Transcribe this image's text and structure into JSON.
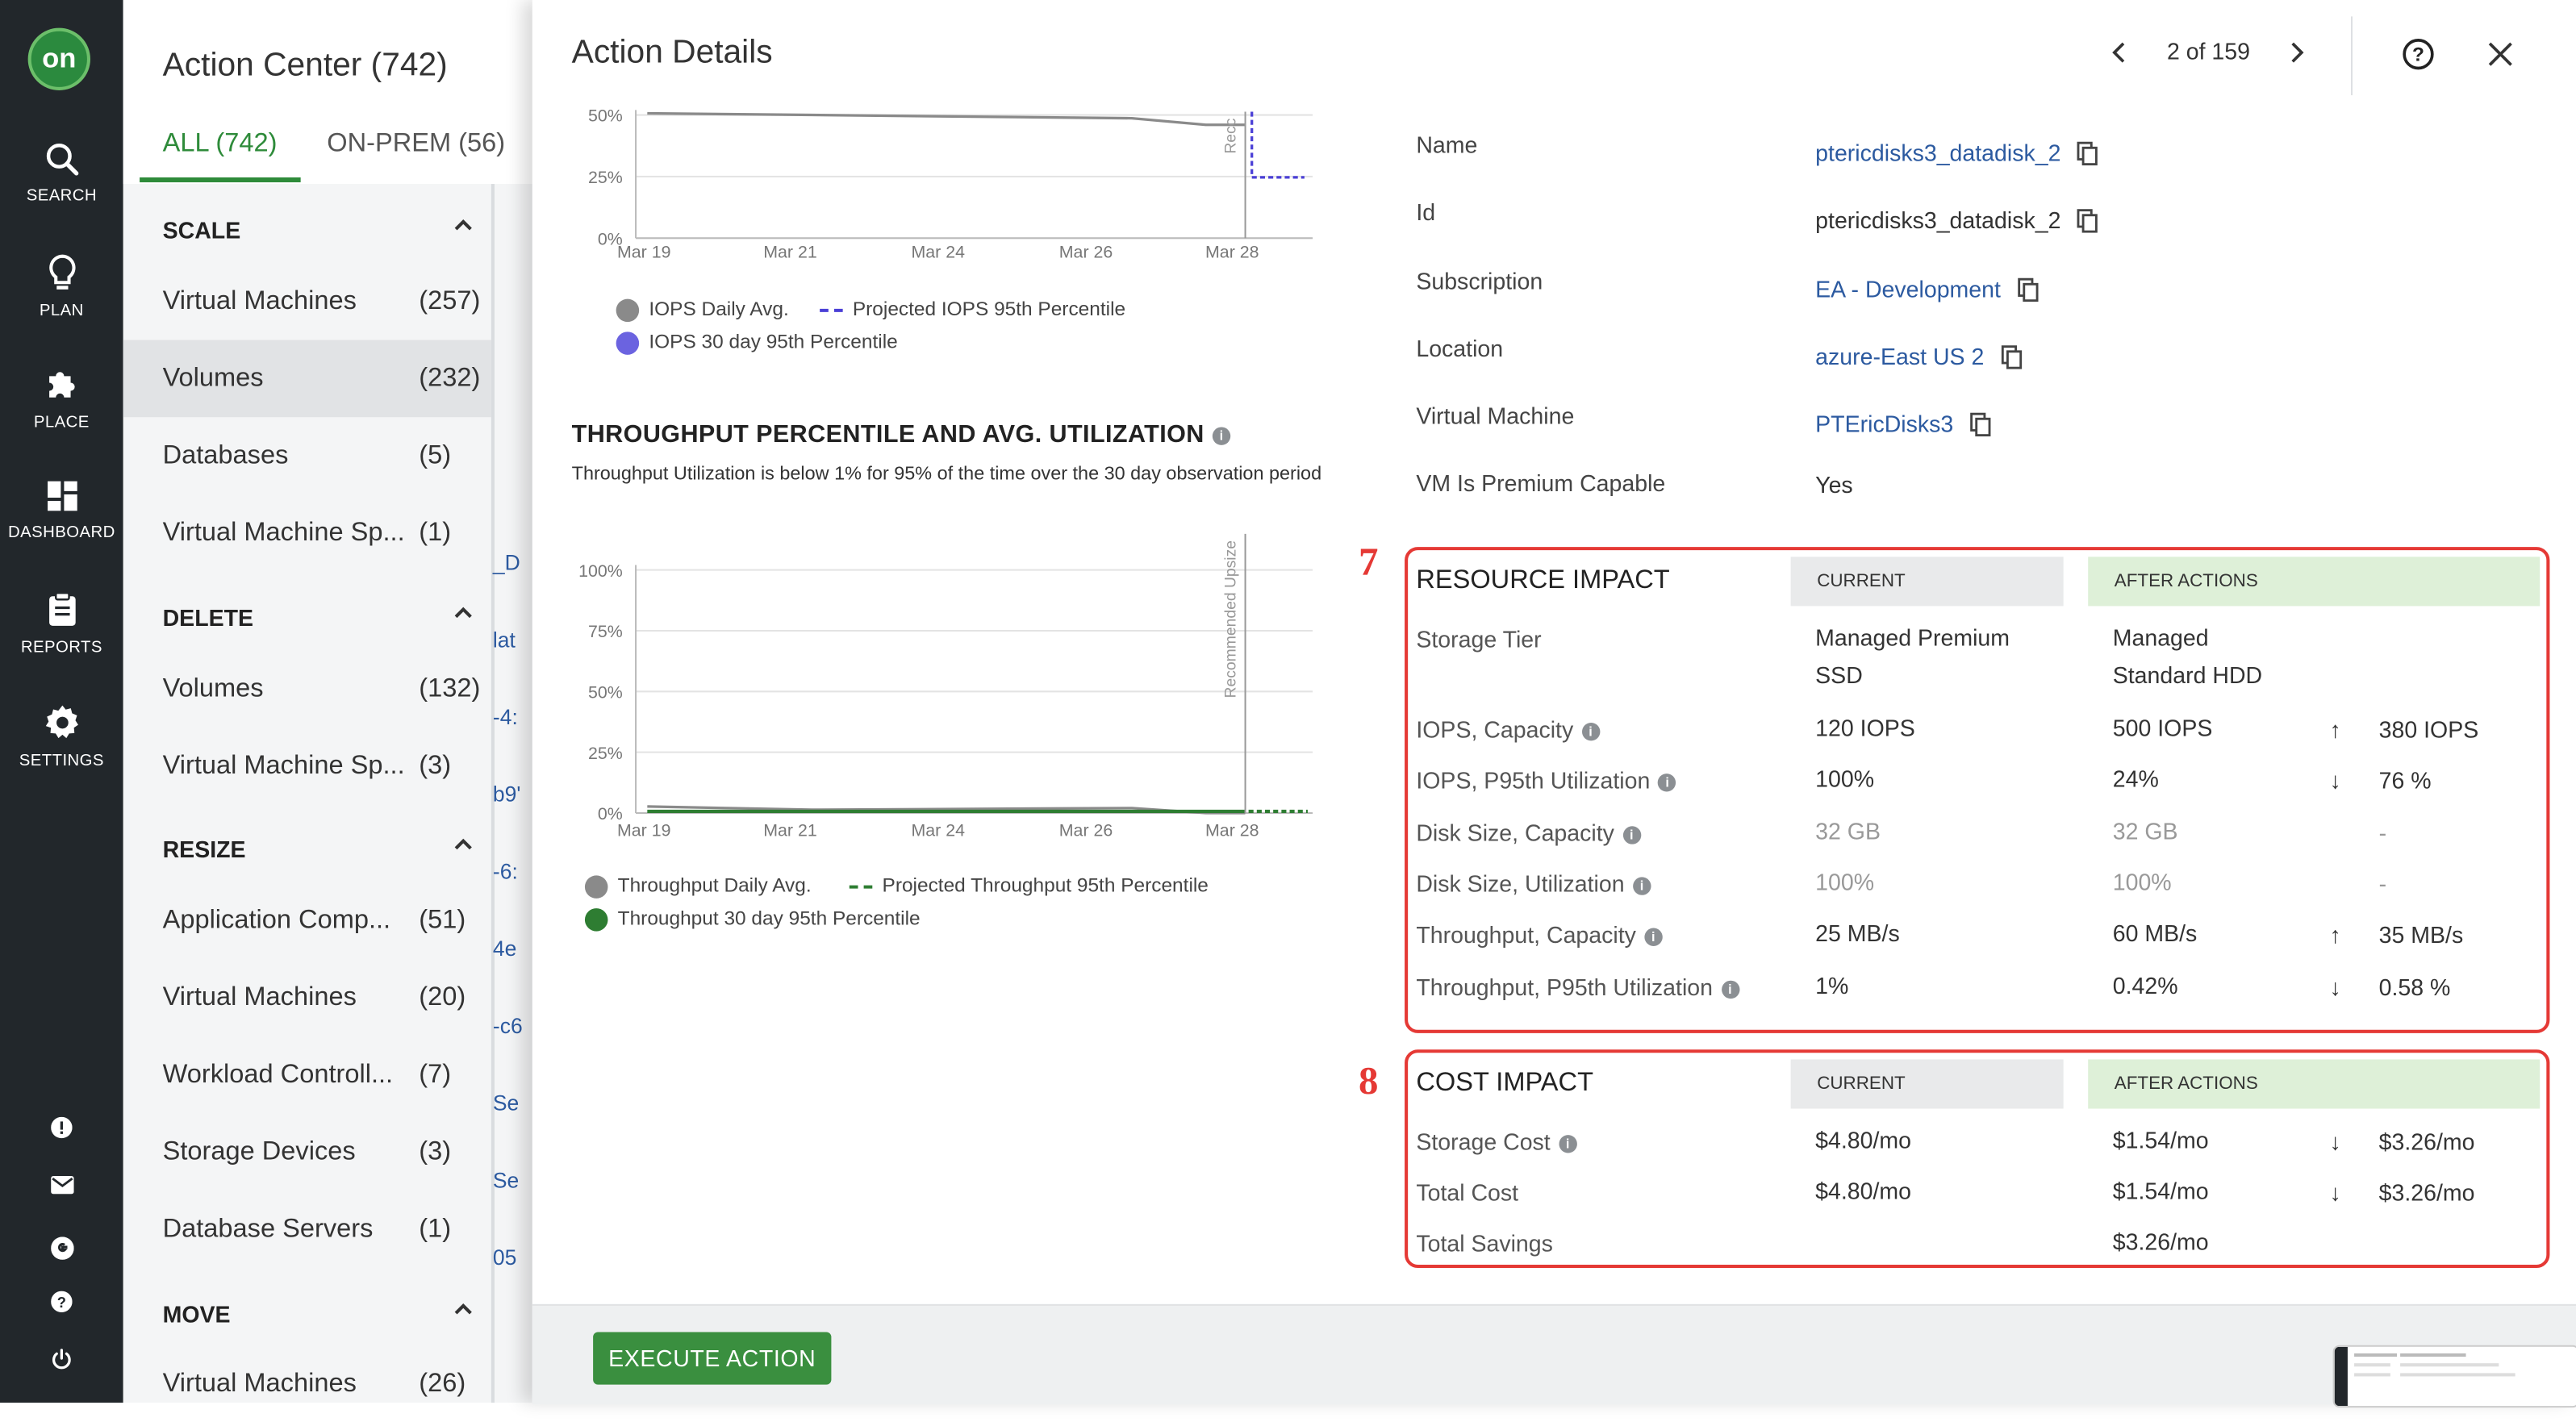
{
  "nav": {
    "logo": "on",
    "items": [
      {
        "icon": "search-icon",
        "label": "SEARCH"
      },
      {
        "icon": "lightbulb-icon",
        "label": "PLAN"
      },
      {
        "icon": "puzzle-icon",
        "label": "PLACE"
      },
      {
        "icon": "dashboard-icon",
        "label": "DASHBOARD"
      },
      {
        "icon": "clipboard-icon",
        "label": "REPORTS"
      },
      {
        "icon": "gear-icon",
        "label": "SETTINGS"
      }
    ]
  },
  "action_center": {
    "title": "Action Center (742)",
    "tabs": [
      "ALL (742)",
      "ON-PREM (56)"
    ],
    "sections": [
      {
        "title": "SCALE",
        "items": [
          {
            "name": "Virtual Machines",
            "count": "(257)"
          },
          {
            "name": "Volumes",
            "count": "(232)"
          },
          {
            "name": "Databases",
            "count": "(5)"
          },
          {
            "name": "Virtual Machine Sp...",
            "count": "(1)"
          }
        ]
      },
      {
        "title": "DELETE",
        "items": [
          {
            "name": "Volumes",
            "count": "(132)"
          },
          {
            "name": "Virtual Machine Sp...",
            "count": "(3)"
          }
        ]
      },
      {
        "title": "RESIZE",
        "items": [
          {
            "name": "Application Comp...",
            "count": "(51)"
          },
          {
            "name": "Virtual Machines",
            "count": "(20)"
          },
          {
            "name": "Workload Controll...",
            "count": "(7)"
          },
          {
            "name": "Storage Devices",
            "count": "(3)"
          },
          {
            "name": "Database Servers",
            "count": "(1)"
          }
        ]
      },
      {
        "title": "MOVE",
        "items": [
          {
            "name": "Virtual Machines",
            "count": "(26)"
          }
        ]
      }
    ],
    "peek": [
      "_D",
      "lat",
      "-4:",
      "b9'",
      "-6:",
      "4e",
      "-c6",
      "Se",
      "Se",
      "05"
    ]
  },
  "details": {
    "title": "Action Details",
    "pager": "2 of 159",
    "properties": [
      {
        "label": "Name",
        "value": "ptericdisks3_datadisk_2",
        "link": true
      },
      {
        "label": "Id",
        "value": "ptericdisks3_datadisk_2",
        "link": false
      },
      {
        "label": "Subscription",
        "value": "EA - Development",
        "link": true
      },
      {
        "label": "Location",
        "value": "azure-East US 2",
        "link": true
      },
      {
        "label": "Virtual Machine",
        "value": "PTEricDisks3",
        "link": true
      },
      {
        "label": "VM Is Premium Capable",
        "value": "Yes",
        "link": false
      }
    ],
    "resource_impact": {
      "marker": "7",
      "title": "RESOURCE IMPACT",
      "current_label": "CURRENT",
      "after_label": "AFTER ACTIONS",
      "rows": [
        {
          "label": "Storage Tier",
          "current": "Managed Premium SSD",
          "after": "Managed Standard HDD",
          "arrow": "",
          "diff": ""
        },
        {
          "label": "IOPS, Capacity",
          "current": "120 IOPS",
          "after": "500 IOPS",
          "arrow": "↑",
          "diff": "380 IOPS"
        },
        {
          "label": "IOPS, P95th Utilization",
          "current": "100%",
          "after": "24%",
          "arrow": "↓",
          "diff": "76 %"
        },
        {
          "label": "Disk Size, Capacity",
          "current": "32 GB",
          "after": "32 GB",
          "arrow": "",
          "diff": "-"
        },
        {
          "label": "Disk Size, Utilization",
          "current": "100%",
          "after": "100%",
          "arrow": "",
          "diff": "-"
        },
        {
          "label": "Throughput, Capacity",
          "current": "25 MB/s",
          "after": "60 MB/s",
          "arrow": "↑",
          "diff": "35 MB/s"
        },
        {
          "label": "Throughput, P95th Utilization",
          "current": "1%",
          "after": "0.42%",
          "arrow": "↓",
          "diff": "0.58 %"
        }
      ]
    },
    "cost_impact": {
      "marker": "8",
      "title": "COST IMPACT",
      "current_label": "CURRENT",
      "after_label": "AFTER ACTIONS",
      "rows": [
        {
          "label": "Storage Cost",
          "current": "$4.80/mo",
          "after": "$1.54/mo",
          "arrow": "↓",
          "diff": "$3.26/mo"
        },
        {
          "label": "Total Cost",
          "current": "$4.80/mo",
          "after": "$1.54/mo",
          "arrow": "↓",
          "diff": "$3.26/mo"
        },
        {
          "label": "Total Savings",
          "current": "",
          "after": "$3.26/mo",
          "arrow": "",
          "diff": ""
        }
      ]
    },
    "execute_label": "EXECUTE ACTION"
  },
  "chart_data": [
    {
      "type": "line",
      "title": "",
      "x": [
        "Mar 19",
        "Mar 21",
        "Mar 24",
        "Mar 26",
        "Mar 28"
      ],
      "yticks": [
        "50%",
        "25%",
        "0%"
      ],
      "ylim": [
        0,
        50
      ],
      "annotation": "Recc",
      "series": [
        {
          "name": "IOPS Daily Avg.",
          "color": "#8a8a8a",
          "style": "solid"
        },
        {
          "name": "Projected IOPS 95th Percentile",
          "color": "#4a3fd6",
          "style": "dashed"
        },
        {
          "name": "IOPS 30 day 95th Percentile",
          "color": "#6b63e0",
          "style": "dot"
        }
      ]
    },
    {
      "type": "line",
      "title": "THROUGHPUT PERCENTILE AND AVG. UTILIZATION",
      "subtitle": "Throughput Utilization is below 1% for 95% of the time over the 30 day observation period",
      "x": [
        "Mar 19",
        "Mar 21",
        "Mar 24",
        "Mar 26",
        "Mar 28"
      ],
      "yticks": [
        "100%",
        "75%",
        "50%",
        "25%",
        "0%"
      ],
      "ylim": [
        0,
        100
      ],
      "annotation": "Recommended Upsize",
      "series": [
        {
          "name": "Throughput Daily Avg.",
          "color": "#8a8a8a",
          "style": "solid"
        },
        {
          "name": "Projected Throughput 95th Percentile",
          "color": "#2e7d32",
          "style": "dashed"
        },
        {
          "name": "Throughput 30 day 95th Percentile",
          "color": "#2e7d32",
          "style": "dot"
        }
      ]
    }
  ]
}
